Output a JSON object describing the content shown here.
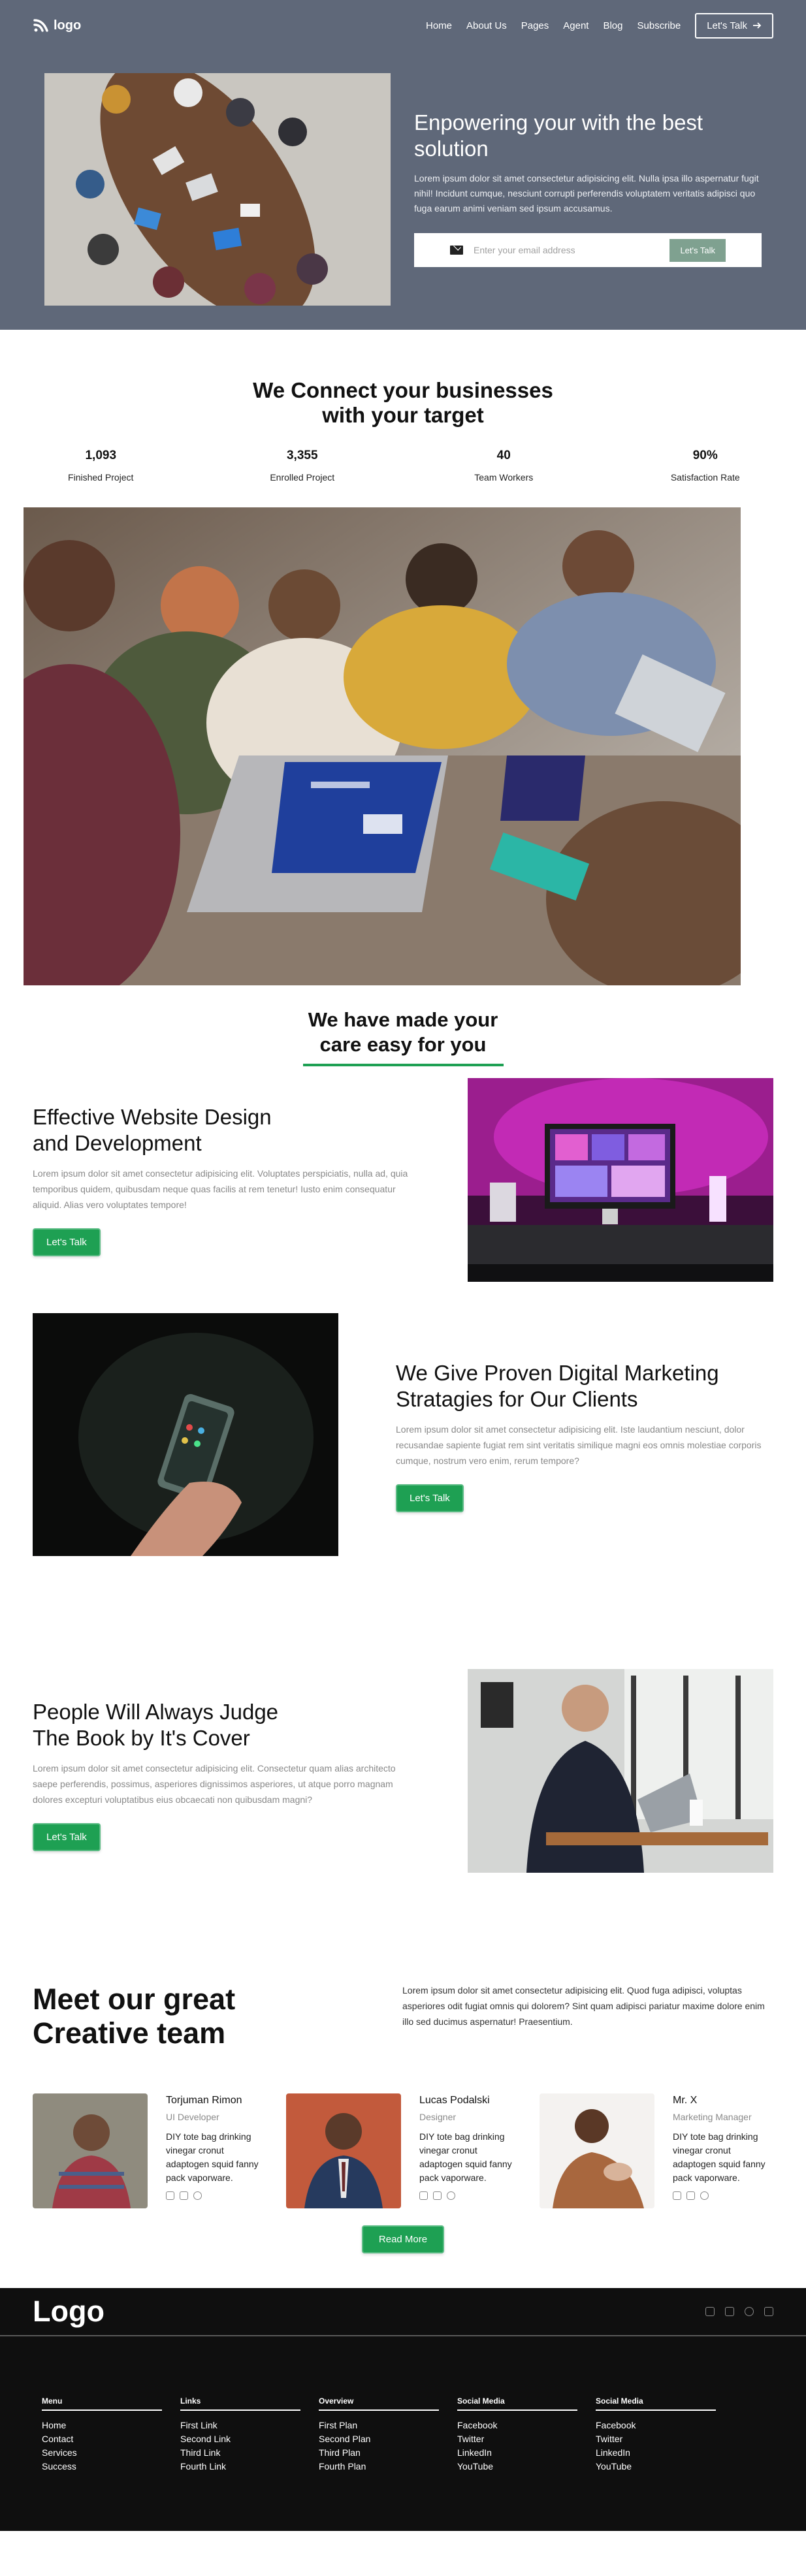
{
  "brand": {
    "logo_text": "logo",
    "accent": "#1ea053",
    "hero_bg": "#5f6879"
  },
  "nav": {
    "links": [
      "Home",
      "About Us",
      "Pages",
      "Agent",
      "Blog",
      "Subscribe"
    ],
    "cta_label": "Let's Talk"
  },
  "hero": {
    "title": "Enpowering your with the best solution",
    "text": "Lorem ipsum dolor sit amet consectetur adipisicing elit. Nulla ipsa illo aspernatur fugit nihil! Incidunt cumque, nesciunt corrupti perferendis voluptatem veritatis adipisci quo fuga earum animi veniam sed ipsum accusamus.",
    "email_placeholder": "Enter your email address",
    "email_button": "Let's Talk"
  },
  "connect": {
    "title_line1": "We Connect your businesses",
    "title_line2": "with your target",
    "stats": [
      {
        "value": "1,093",
        "label": "Finished Project"
      },
      {
        "value": "3,355",
        "label": "Enrolled Project"
      },
      {
        "value": "40",
        "label": "Team Workers"
      },
      {
        "value": "90%",
        "label": "Satisfaction Rate"
      }
    ]
  },
  "care": {
    "title_line1": "We have made your",
    "title_line2": "care easy for you"
  },
  "features": [
    {
      "title_line1": "Effective Website Design",
      "title_line2": "and Development",
      "text": "Lorem ipsum dolor sit amet consectetur adipisicing elit. Voluptates perspiciatis, nulla ad, quia temporibus quidem, quibusdam neque quas facilis at rem tenetur! Iusto enim consequatur aliquid. Alias vero voluptates tempore!",
      "button": "Let's Talk"
    },
    {
      "title_line1": "We Give Proven Digital Marketing",
      "title_line2": "Stratagies for Our Clients",
      "text": "Lorem ipsum dolor sit amet consectetur adipisicing elit. Iste laudantium nesciunt, dolor recusandae sapiente fugiat rem sint veritatis similique magni eos omnis molestiae corporis cumque, nostrum vero enim, rerum tempore?",
      "button": "Let's Talk"
    },
    {
      "title_line1": "People Will Always Judge",
      "title_line2": "The Book by It's Cover",
      "text": "Lorem ipsum dolor sit amet consectetur adipisicing elit. Consectetur quam alias architecto saepe perferendis, possimus, asperiores dignissimos asperiores, ut atque porro magnam dolores excepturi voluptatibus eius obcaecati non quibusdam magni?",
      "button": "Let's Talk"
    }
  ],
  "team": {
    "title_line1": "Meet our great",
    "title_line2": "Creative team",
    "intro": "Lorem ipsum dolor sit amet consectetur adipisicing elit. Quod fuga adipisci, voluptas asperiores odit fugiat omnis qui dolorem? Sint quam adipisci pariatur maxime dolore enim illo sed ducimus aspernatur! Praesentium.",
    "members": [
      {
        "name": "Torjuman Rimon",
        "role": "UI Developer",
        "bio": "DIY tote bag drinking vinegar cronut adaptogen squid fanny pack vaporware."
      },
      {
        "name": "Lucas Podalski",
        "role": "Designer",
        "bio": "DIY tote bag drinking vinegar cronut adaptogen squid fanny pack vaporware."
      },
      {
        "name": "Mr. X",
        "role": "Marketing Manager",
        "bio": "DIY tote bag drinking vinegar cronut adaptogen squid fanny pack vaporware."
      }
    ],
    "read_more": "Read More"
  },
  "footer": {
    "logo": "Logo",
    "social_icons": [
      "facebook-icon",
      "twitter-icon",
      "instagram-icon",
      "linkedin-icon"
    ],
    "columns": [
      {
        "title": "Menu",
        "links": [
          "Home",
          "Contact",
          "Services",
          "Success"
        ]
      },
      {
        "title": "Links",
        "links": [
          "First Link",
          "Second Link",
          "Third Link",
          "Fourth Link"
        ]
      },
      {
        "title": "Overview",
        "links": [
          "First Plan",
          "Second Plan",
          "Third Plan",
          "Fourth Plan"
        ]
      },
      {
        "title": "Social Media",
        "links": [
          "Facebook",
          "Twitter",
          "LinkedIn",
          "YouTube"
        ]
      },
      {
        "title": "Social Media",
        "links": [
          "Facebook",
          "Twitter",
          "LinkedIn",
          "YouTube"
        ]
      }
    ]
  }
}
